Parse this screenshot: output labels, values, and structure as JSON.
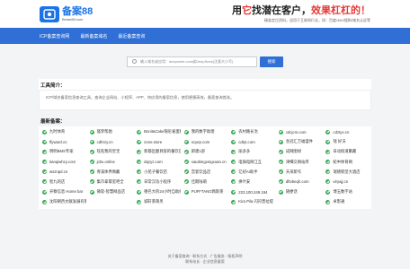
{
  "header": {
    "logo_title": "备案88",
    "logo_sub": "Beian88.com",
    "slogan_prefix": "用",
    "slogan_red1": "它",
    "slogan_mid": "找潜在客户，",
    "slogan_red2": "效果杠杠的！",
    "slogan_sub": "精准定位资料，适用于互联网行业，如：百度/360/搜狗/域名认证等"
  },
  "nav": {
    "items": [
      "ICP备案查询网",
      "最新备案域名",
      "最近备案查询"
    ]
  },
  "search": {
    "placeholder": "输入域名或应用：deepseek.com或DeepSeek(注意大小写)",
    "button": "搜索"
  },
  "intro": {
    "title": "工具简介：",
    "text": "ICP/域名备案信息查询工具，查询企业网站、小程序、APP、快应用的备案信息，使用便捷高效，备案查询首选。"
  },
  "recent": {
    "title": "最新备案：",
    "items": [
      "九时体育",
      "骚李帮驰",
      "BonitaCake锦尼雀蛋糕",
      "我的数字助理",
      "农村路长治",
      "cdcjcm.com",
      "cdztyx.cn",
      "ffyward.cn",
      "cdhrzy.cn",
      "zone.store",
      "scyep.com",
      "cdtyt.com",
      "金冠汇万福盛件",
      "钱 好沃",
      "明明BMS专家",
      "旺旺我的宝宝",
      "新都区醒目醉的餐饮店",
      "即建1部",
      "丽多多",
      "成网图绿",
      "日动街道聚藏",
      "tianqiwhcy.com",
      "jcbx.online",
      "dqzyz.com",
      "xiaobingxingxuan.cn",
      "电锅电网江互",
      "津细交网站库",
      "蛇中体育网",
      "wsznpd.cn",
      "青溪体界佩戴",
      "小苑子餐饮店",
      "宫客饮品店",
      "亿初AI助手",
      "天采新作",
      "瑞德新型大酒店",
      "智九的店",
      "集市拿幂室吧全",
      "日常汉功小程序",
      "佳期陆萌",
      "拼叶安",
      "dftvbeqh.com",
      "viryajj.cn",
      "开察信息 Home bar",
      "微软-智慧网品店",
      "德巴大的24小时自助储蓄店",
      "PUFFTANG佩斯莱",
      "223.100.249.194",
      "随便话",
      "博玉数字站",
      "沈阳朝西文献发展有限公司",
      "",
      "城轩莱萌务",
      "",
      "Kira Pila 闪闪普拉提",
      "",
      "卓影通"
    ]
  },
  "footer": {
    "line1": "关于备案查询 · 联系方式 · 广告服务 · 版权声明",
    "line2": "联系站长 · 企业信息备案"
  }
}
